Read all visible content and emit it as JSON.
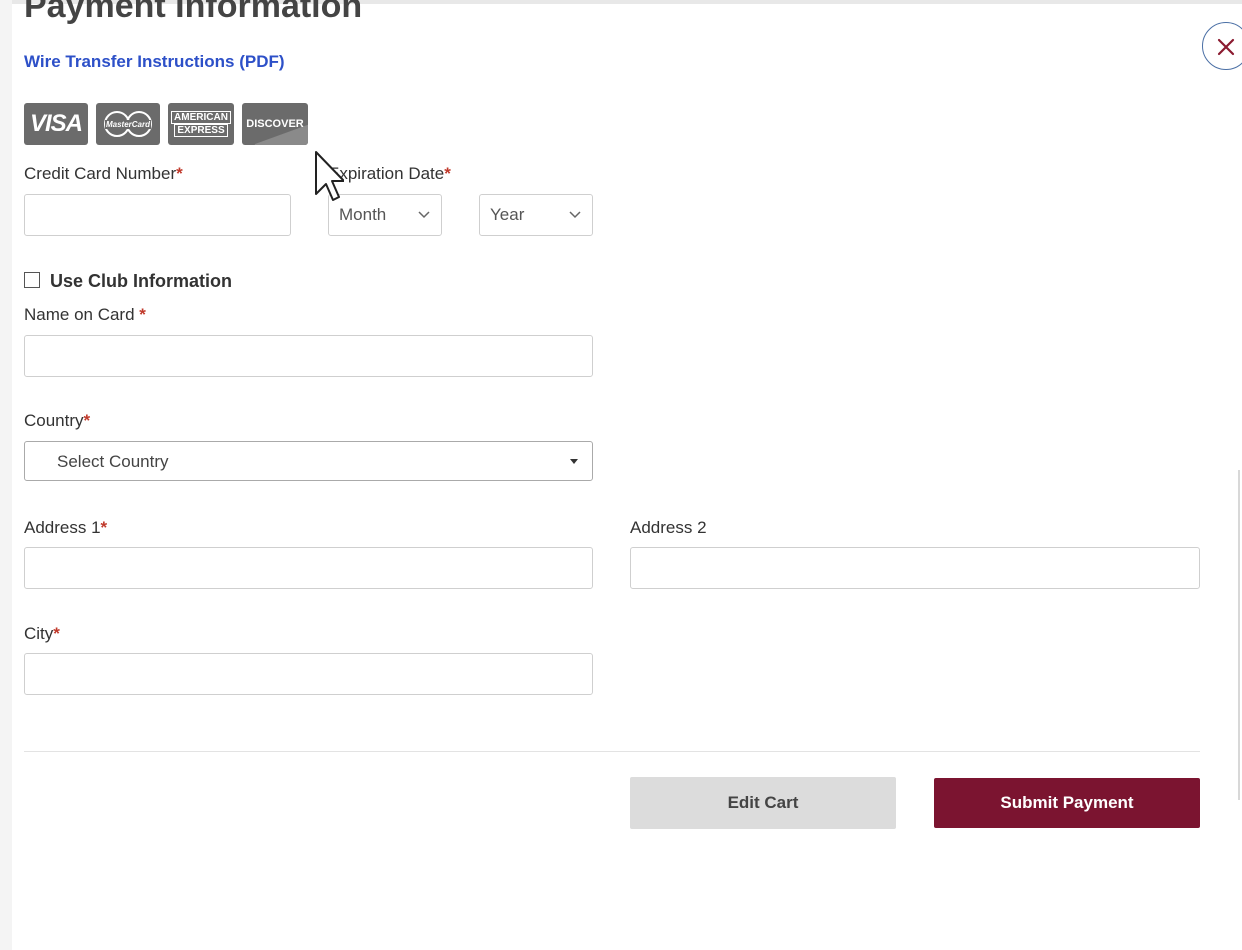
{
  "page": {
    "title": "Payment Information",
    "wire_link": "Wire Transfer Instructions (PDF)",
    "close_label": "Close"
  },
  "cards": {
    "visa": "VISA",
    "mastercard": "MasterCard",
    "amex_line1": "AMERICAN",
    "amex_line2": "EXPRESS",
    "discover": "DISCOVER"
  },
  "form": {
    "required_mark": "*",
    "credit_card_label": "Credit Card Number",
    "credit_card_value": "",
    "expiration_label": "Expiration Date",
    "month_selected": "Month",
    "year_selected": "Year",
    "use_club_label": "Use Club Information",
    "use_club_checked": false,
    "name_label": "Name on Card",
    "name_value": "",
    "country_label": "Country",
    "country_selected": "Select Country",
    "address1_label": "Address 1",
    "address1_value": "",
    "address2_label": "Address 2",
    "address2_value": "",
    "city_label": "City",
    "city_value": ""
  },
  "actions": {
    "edit_cart": "Edit Cart",
    "submit_payment": "Submit Payment"
  },
  "colors": {
    "link": "#2d50c8",
    "submit_bg": "#7b1430",
    "required": "#c0392b",
    "close_x": "#8b1a30"
  }
}
